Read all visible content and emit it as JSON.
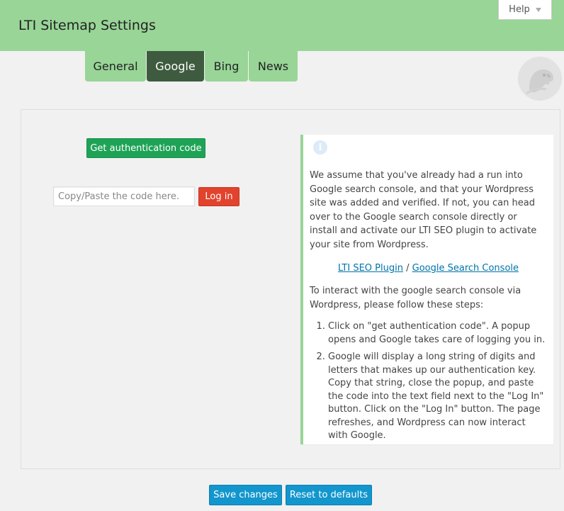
{
  "header": {
    "title": "LTI Sitemap Settings",
    "background": "#98d597",
    "help_label": "Help"
  },
  "tabs": [
    {
      "label": "General",
      "active": false
    },
    {
      "label": "Google",
      "active": true
    },
    {
      "label": "Bing",
      "active": false
    },
    {
      "label": "News",
      "active": false
    }
  ],
  "google": {
    "auth_button_label": "Get authentication code",
    "code_input": {
      "value": "",
      "placeholder": "Copy/Paste the code here."
    },
    "login_button_label": "Log in"
  },
  "info": {
    "icon": "info-icon",
    "paragraph1": "We assume that you've already had a run into Google search console, and that your Wordpress site was added and verified. If not, you can head over to the Google search console directly or install and activate our LTI SEO plugin to activate your site from Wordpress.",
    "link1": "LTI SEO Plugin",
    "link_separator": "/",
    "link2": "Google Search Console",
    "paragraph2": "To interact with the google search console via Wordpress, please follow these steps:",
    "steps": [
      "Click on \"get authentication code\". A popup opens and Google takes care of logging you in.",
      "Google will display a long string of digits and letters that makes up our authentication key. Copy that string, close the popup, and paste the code into the text field next to the \"Log In\" button. Click on the \"Log In\" button. The page refreshes, and Wordpress can now interact with Google."
    ]
  },
  "footer": {
    "save_label": "Save changes",
    "reset_label": "Reset to defaults"
  },
  "colors": {
    "header_green": "#98d597",
    "active_tab": "#3f5b3f",
    "auth_button": "#1ea356",
    "login_button": "#e2432d",
    "primary_button": "#1296cd",
    "link": "#0073aa"
  }
}
